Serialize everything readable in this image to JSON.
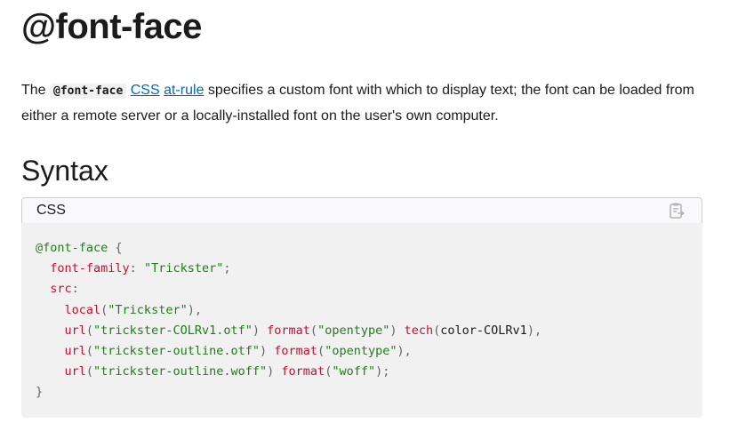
{
  "page": {
    "title": "@font-face",
    "intro": {
      "prefix": "The ",
      "code": "@font-face",
      "link1": "CSS",
      "link2": "at-rule",
      "rest": " specifies a custom font with which to display text; the font can be loaded from either a remote server or a locally-installed font on the user's own computer."
    },
    "syntax_heading": "Syntax",
    "code_language": "CSS",
    "copy_icon": "clipboard-icon",
    "code": {
      "at_rule": "@font-face",
      "open_brace": "{",
      "close_brace": "}",
      "line1_prop": "font-family",
      "line1_value": "\"Trickster\"",
      "line2_prop": "src",
      "local_fn": "local",
      "local_arg": "\"Trickster\"",
      "url1_arg": "\"trickster-COLRv1.otf\"",
      "format1_arg": "\"opentype\"",
      "tech_fn": "tech",
      "tech_arg": "color-COLRv1",
      "url2_arg": "\"trickster-outline.otf\"",
      "format2_arg": "\"opentype\"",
      "url3_arg": "\"trickster-outline.woff\"",
      "format3_arg": "\"woff\"",
      "url_fn": "url",
      "format_fn": "format"
    }
  }
}
